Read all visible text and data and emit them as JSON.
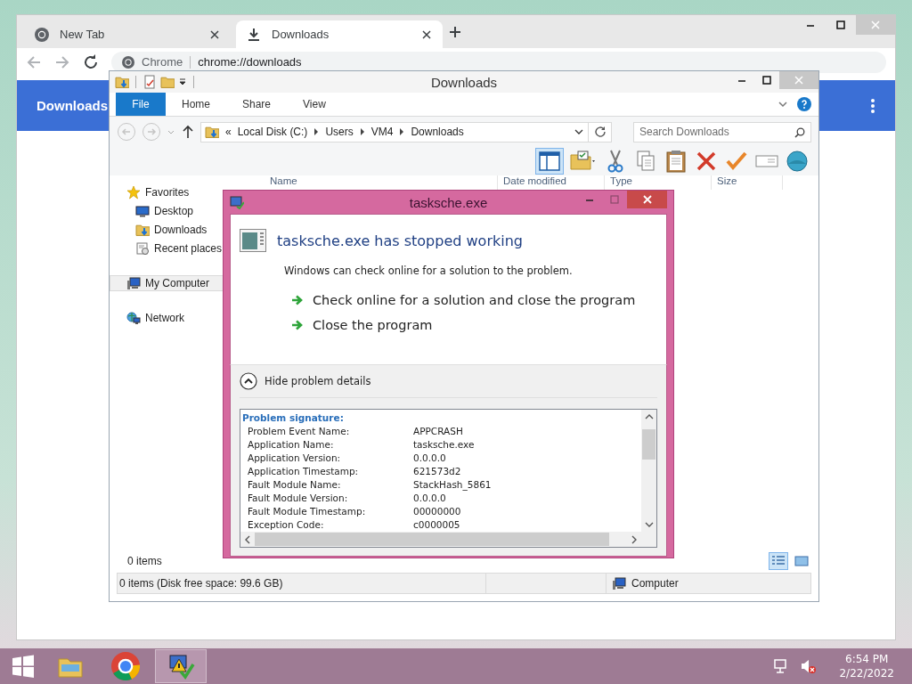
{
  "browser": {
    "tabs": [
      {
        "label": "New Tab",
        "kind": "newtab",
        "selected": false
      },
      {
        "label": "Downloads",
        "kind": "downloads",
        "selected": true
      }
    ],
    "omnibox": {
      "site_chip": "Chrome",
      "url": "chrome://downloads"
    },
    "page_header": "Downloads"
  },
  "explorer": {
    "title": "Downloads",
    "ribbon_tabs": [
      {
        "label": "File",
        "kind": "file",
        "selected": false
      },
      {
        "label": "Home",
        "kind": "tab",
        "selected": false
      },
      {
        "label": "Share",
        "kind": "tab",
        "selected": false
      },
      {
        "label": "View",
        "kind": "tab",
        "selected": false
      }
    ],
    "address": {
      "overflow_mark": "«",
      "crumbs": [
        "Local Disk (C:)",
        "Users",
        "VM4",
        "Downloads"
      ]
    },
    "search": {
      "placeholder": "Search Downloads"
    },
    "toolbar": [
      {
        "kind": "preview-pane",
        "selected": true
      },
      {
        "kind": "folder-options",
        "selected": false
      },
      {
        "kind": "cut",
        "selected": false
      },
      {
        "kind": "copy",
        "selected": false
      },
      {
        "kind": "paste",
        "selected": false
      },
      {
        "kind": "delete",
        "selected": false
      },
      {
        "kind": "properties",
        "selected": false
      },
      {
        "kind": "rename",
        "selected": false
      },
      {
        "kind": "globe",
        "selected": false
      }
    ],
    "columns": [
      "Name",
      "Date modified",
      "Type",
      "Size"
    ],
    "nav": [
      {
        "label": "Favorites",
        "kind": "favorites",
        "selected": false,
        "children": [
          {
            "label": "Desktop",
            "kind": "desktop",
            "selected": false
          },
          {
            "label": "Downloads",
            "kind": "downloads",
            "selected": false
          },
          {
            "label": "Recent places",
            "kind": "recent",
            "selected": false
          }
        ]
      },
      {
        "label": "My Computer",
        "kind": "computer",
        "selected": true
      },
      {
        "label": "Network",
        "kind": "network",
        "selected": false
      }
    ],
    "item_count": "0 items",
    "views": [
      {
        "kind": "details",
        "selected": true
      },
      {
        "kind": "large-icons",
        "selected": false
      }
    ],
    "status": "0 items (Disk free space: 99.6 GB)",
    "status_location": "Computer"
  },
  "dialog": {
    "title": "tasksche.exe",
    "heading": "tasksche.exe has stopped working",
    "message": "Windows can check online for a solution to the problem.",
    "actions": [
      "Check online for a solution and close the program",
      "Close the program"
    ],
    "details_toggle": "Hide problem details",
    "details": {
      "heading": "Problem signature:",
      "rows": [
        {
          "label": "Problem Event Name:",
          "value": "APPCRASH"
        },
        {
          "label": "Application Name:",
          "value": "tasksche.exe"
        },
        {
          "label": "Application Version:",
          "value": "0.0.0.0"
        },
        {
          "label": "Application Timestamp:",
          "value": "621573d2"
        },
        {
          "label": "Fault Module Name:",
          "value": "StackHash_5861"
        },
        {
          "label": "Fault Module Version:",
          "value": "0.0.0.0"
        },
        {
          "label": "Fault Module Timestamp:",
          "value": "00000000"
        },
        {
          "label": "Exception Code:",
          "value": "c0000005"
        }
      ]
    }
  },
  "taskbar": {
    "apps": [
      {
        "kind": "explorer",
        "selected": false
      },
      {
        "kind": "chrome",
        "selected": false
      },
      {
        "kind": "problem-reports",
        "selected": true
      }
    ],
    "time": "6:54 PM",
    "date": "2/22/2022"
  }
}
